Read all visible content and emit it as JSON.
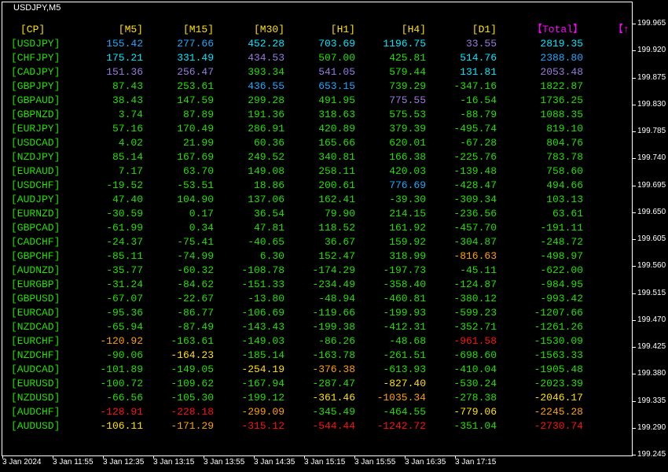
{
  "chart": {
    "symbol": "USDJPY,M5"
  },
  "palette": {
    "g": "#22e000",
    "c": "#00e8ff",
    "b": "#1ea8ff",
    "p": "#9a7ae0",
    "y": "#ffe000",
    "o": "#ffa000",
    "r": "#ff1010",
    "magenta": "#ff00ff",
    "header": "#ffe000"
  },
  "table": {
    "headers": [
      "[CP]",
      "[M5]",
      "[M15]",
      "[M30]",
      "[H1]",
      "[H4]",
      "[D1]",
      "【Total】"
    ],
    "extra_header": "【↑",
    "rows": [
      {
        "pair": "[USDJPY]",
        "values": [
          "155.42",
          "277.66",
          "452.28",
          "703.69",
          "1196.75",
          "33.55",
          "2819.35"
        ],
        "colors": [
          "b",
          "b",
          "c",
          "c",
          "c",
          "p",
          "c"
        ]
      },
      {
        "pair": "[CHFJPY]",
        "values": [
          "175.21",
          "331.49",
          "434.53",
          "507.00",
          "425.81",
          "514.76",
          "2388.80"
        ],
        "colors": [
          "c",
          "c",
          "p",
          "g",
          "g",
          "c",
          "b"
        ]
      },
      {
        "pair": "[CADJPY]",
        "values": [
          "151.36",
          "256.47",
          "393.34",
          "541.05",
          "579.44",
          "131.81",
          "2053.48"
        ],
        "colors": [
          "p",
          "p",
          "g",
          "p",
          "g",
          "c",
          "p"
        ]
      },
      {
        "pair": "[GBPJPY]",
        "values": [
          "87.43",
          "253.61",
          "436.55",
          "653.15",
          "739.29",
          "-347.16",
          "1822.87"
        ],
        "colors": [
          "g",
          "g",
          "b",
          "b",
          "g",
          "g",
          "g"
        ]
      },
      {
        "pair": "[GBPAUD]",
        "values": [
          "38.43",
          "147.59",
          "299.28",
          "491.95",
          "775.55",
          "-16.54",
          "1736.25"
        ],
        "colors": [
          "g",
          "g",
          "g",
          "g",
          "p",
          "g",
          "g"
        ]
      },
      {
        "pair": "[GBPNZD]",
        "values": [
          "3.74",
          "87.89",
          "191.36",
          "318.63",
          "575.53",
          "-88.79",
          "1088.35"
        ],
        "colors": [
          "g",
          "g",
          "g",
          "g",
          "g",
          "g",
          "g"
        ]
      },
      {
        "pair": "[EURJPY]",
        "values": [
          "57.16",
          "170.49",
          "286.91",
          "420.89",
          "379.39",
          "-495.74",
          "819.10"
        ],
        "colors": [
          "g",
          "g",
          "g",
          "g",
          "g",
          "g",
          "g"
        ]
      },
      {
        "pair": "[USDCAD]",
        "values": [
          "4.02",
          "21.99",
          "60.36",
          "165.66",
          "620.01",
          "-67.28",
          "804.76"
        ],
        "colors": [
          "g",
          "g",
          "g",
          "g",
          "g",
          "g",
          "g"
        ]
      },
      {
        "pair": "[NZDJPY]",
        "values": [
          "85.14",
          "167.69",
          "249.52",
          "340.81",
          "166.38",
          "-225.76",
          "783.78"
        ],
        "colors": [
          "g",
          "g",
          "g",
          "g",
          "g",
          "g",
          "g"
        ]
      },
      {
        "pair": "[EURAUD]",
        "values": [
          "7.17",
          "63.70",
          "149.08",
          "258.11",
          "420.03",
          "-139.48",
          "758.60"
        ],
        "colors": [
          "g",
          "g",
          "g",
          "g",
          "g",
          "g",
          "g"
        ]
      },
      {
        "pair": "[USDCHF]",
        "values": [
          "-19.52",
          "-53.51",
          "18.86",
          "200.61",
          "776.69",
          "-428.47",
          "494.66"
        ],
        "colors": [
          "g",
          "g",
          "g",
          "g",
          "b",
          "g",
          "g"
        ]
      },
      {
        "pair": "[AUDJPY]",
        "values": [
          "47.40",
          "104.90",
          "137.06",
          "162.41",
          "-39.30",
          "-309.34",
          "103.13"
        ],
        "colors": [
          "g",
          "g",
          "g",
          "g",
          "g",
          "g",
          "g"
        ]
      },
      {
        "pair": "[EURNZD]",
        "values": [
          "-30.59",
          "0.17",
          "36.54",
          "79.90",
          "214.15",
          "-236.56",
          "63.61"
        ],
        "colors": [
          "g",
          "g",
          "g",
          "g",
          "g",
          "g",
          "g"
        ]
      },
      {
        "pair": "[GBPCAD]",
        "values": [
          "-61.99",
          "0.34",
          "47.81",
          "118.52",
          "161.92",
          "-457.70",
          "-191.11"
        ],
        "colors": [
          "g",
          "g",
          "g",
          "g",
          "g",
          "g",
          "g"
        ]
      },
      {
        "pair": "[CADCHF]",
        "values": [
          "-24.37",
          "-75.41",
          "-40.65",
          "36.67",
          "159.92",
          "-304.87",
          "-248.72"
        ],
        "colors": [
          "g",
          "g",
          "g",
          "g",
          "g",
          "g",
          "g"
        ]
      },
      {
        "pair": "[GBPCHF]",
        "values": [
          "-85.11",
          "-74.99",
          "6.30",
          "152.47",
          "318.99",
          "-816.63",
          "-498.97"
        ],
        "colors": [
          "g",
          "g",
          "g",
          "g",
          "g",
          "o",
          "g"
        ]
      },
      {
        "pair": "[AUDNZD]",
        "values": [
          "-35.77",
          "-60.32",
          "-108.78",
          "-174.29",
          "-197.73",
          "-45.11",
          "-622.00"
        ],
        "colors": [
          "g",
          "g",
          "g",
          "g",
          "g",
          "g",
          "g"
        ]
      },
      {
        "pair": "[EURGBP]",
        "values": [
          "-31.24",
          "-84.62",
          "-151.33",
          "-234.49",
          "-358.40",
          "-124.87",
          "-984.95"
        ],
        "colors": [
          "g",
          "g",
          "g",
          "g",
          "g",
          "g",
          "g"
        ]
      },
      {
        "pair": "[GBPUSD]",
        "values": [
          "-67.07",
          "-22.67",
          "-13.80",
          "-48.94",
          "-460.81",
          "-380.12",
          "-993.42"
        ],
        "colors": [
          "g",
          "g",
          "g",
          "g",
          "g",
          "g",
          "g"
        ]
      },
      {
        "pair": "[EURCAD]",
        "values": [
          "-95.36",
          "-86.77",
          "-106.69",
          "-119.66",
          "-199.93",
          "-599.23",
          "-1207.66"
        ],
        "colors": [
          "g",
          "g",
          "g",
          "g",
          "g",
          "g",
          "g"
        ]
      },
      {
        "pair": "[NZDCAD]",
        "values": [
          "-65.94",
          "-87.49",
          "-143.43",
          "-199.38",
          "-412.31",
          "-352.71",
          "-1261.26"
        ],
        "colors": [
          "g",
          "g",
          "g",
          "g",
          "g",
          "g",
          "g"
        ]
      },
      {
        "pair": "[EURCHF]",
        "values": [
          "-120.92",
          "-163.61",
          "-149.03",
          "-86.26",
          "-48.68",
          "-961.58",
          "-1530.09"
        ],
        "colors": [
          "o",
          "g",
          "g",
          "g",
          "g",
          "r",
          "g"
        ]
      },
      {
        "pair": "[NZDCHF]",
        "values": [
          "-90.06",
          "-164.23",
          "-185.14",
          "-163.78",
          "-261.51",
          "-698.60",
          "-1563.33"
        ],
        "colors": [
          "g",
          "y",
          "g",
          "g",
          "g",
          "g",
          "g"
        ]
      },
      {
        "pair": "[AUDCAD]",
        "values": [
          "-101.89",
          "-149.05",
          "-254.19",
          "-376.38",
          "-613.93",
          "-410.04",
          "-1905.48"
        ],
        "colors": [
          "g",
          "g",
          "y",
          "o",
          "g",
          "g",
          "g"
        ]
      },
      {
        "pair": "[EURUSD]",
        "values": [
          "-100.72",
          "-109.62",
          "-167.94",
          "-287.47",
          "-827.40",
          "-530.24",
          "-2023.39"
        ],
        "colors": [
          "g",
          "g",
          "g",
          "g",
          "y",
          "g",
          "g"
        ]
      },
      {
        "pair": "[NZDUSD]",
        "values": [
          "-66.56",
          "-105.30",
          "-199.12",
          "-361.46",
          "-1035.34",
          "-278.38",
          "-2046.17"
        ],
        "colors": [
          "g",
          "g",
          "g",
          "y",
          "o",
          "g",
          "y"
        ]
      },
      {
        "pair": "[AUDCHF]",
        "values": [
          "-128.91",
          "-228.18",
          "-299.09",
          "-345.49",
          "-464.55",
          "-779.06",
          "-2245.28"
        ],
        "colors": [
          "r",
          "r",
          "o",
          "g",
          "g",
          "y",
          "o"
        ]
      },
      {
        "pair": "[AUDUSD]",
        "values": [
          "-106.11",
          "-171.29",
          "-315.12",
          "-544.44",
          "-1242.72",
          "-351.04",
          "-2730.74"
        ],
        "colors": [
          "y",
          "o",
          "r",
          "r",
          "r",
          "g",
          "r"
        ]
      }
    ]
  },
  "price_axis": [
    "199.965",
    "199.920",
    "199.875",
    "199.830",
    "199.785",
    "199.740",
    "199.695",
    "199.650",
    "199.605",
    "199.560",
    "199.515",
    "199.470",
    "199.425",
    "199.380",
    "199.335",
    "199.290",
    "199.245"
  ],
  "time_axis": [
    "3 Jan 2024",
    "3 Jan 11:55",
    "3 Jan 12:35",
    "3 Jan 13:15",
    "3 Jan 13:55",
    "3 Jan 14:35",
    "3 Jan 15:15",
    "3 Jan 15:55",
    "3 Jan 16:35",
    "3 Jan 17:15"
  ]
}
